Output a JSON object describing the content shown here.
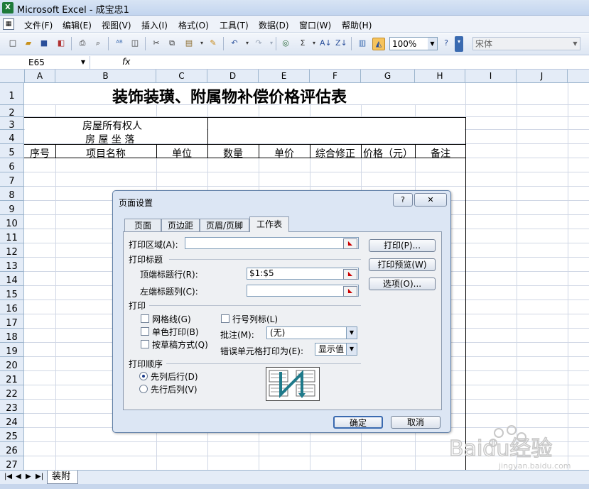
{
  "window": {
    "title": "Microsoft Excel - 成宝忠1"
  },
  "menu": [
    "文件(F)",
    "编辑(E)",
    "视图(V)",
    "插入(I)",
    "格式(O)",
    "工具(T)",
    "数据(D)",
    "窗口(W)",
    "帮助(H)"
  ],
  "toolbar": {
    "zoom": "100%",
    "font": "宋体"
  },
  "formula_bar": {
    "name_box": "E65",
    "fx": "fx"
  },
  "columns": [
    "A",
    "B",
    "C",
    "D",
    "E",
    "F",
    "G",
    "H",
    "I",
    "J"
  ],
  "rows": [
    "1",
    "2",
    "3",
    "4",
    "5",
    "6",
    "7",
    "8",
    "9",
    "10",
    "11",
    "12",
    "13",
    "14",
    "15",
    "16",
    "17",
    "18",
    "19",
    "20",
    "21",
    "22",
    "23",
    "24",
    "25",
    "26",
    "27"
  ],
  "sheet": {
    "title": "装饰装璜、附属物补偿价格评估表",
    "owner_label": "房屋所有权人",
    "location_label": "房 屋 坐 落",
    "headers": [
      "序号",
      "项目名称",
      "单位",
      "数量",
      "单价",
      "综合修正",
      "价格（元）",
      "备注"
    ]
  },
  "sheet_tabs": {
    "active": "装附"
  },
  "dialog": {
    "title": "页面设置",
    "help_btn": "?",
    "close_btn": "✕",
    "tabs": [
      "页面",
      "页边距",
      "页眉/页脚",
      "工作表"
    ],
    "active_tab": "工作表",
    "print_area_label": "打印区域(A):",
    "print_area_value": "",
    "print_titles_label": "打印标题",
    "top_rows_label": "顶端标题行(R):",
    "top_rows_value": "$1:$5",
    "left_cols_label": "左端标题列(C):",
    "left_cols_value": "",
    "print_section_label": "打印",
    "gridlines_label": "网格线(G)",
    "mono_label": "单色打印(B)",
    "draft_label": "按草稿方式(Q)",
    "row_col_headers_label": "行号列标(L)",
    "comments_label": "批注(M):",
    "comments_value": "(无)",
    "errors_label": "错误单元格打印为(E):",
    "errors_value": "显示值",
    "page_order_label": "打印顺序",
    "down_then_over": "先列后行(D)",
    "over_then_down": "先行后列(V)",
    "selected_order": "先列后行(D)",
    "print_btn": "打印(P)...",
    "preview_btn": "打印预览(W)",
    "options_btn": "选项(O)...",
    "ok_btn": "确定",
    "cancel_btn": "取消"
  },
  "watermark": {
    "text": "Baidu经验",
    "url": "jingyan.baidu.com"
  },
  "colors": {
    "accent": "#1e7a3a",
    "header_bg": "#e4ecf7",
    "dialog_bg": "#dce6f4"
  }
}
